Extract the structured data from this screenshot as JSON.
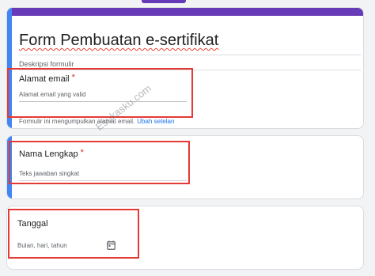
{
  "form": {
    "title": "Form Pembuatan e-sertifikat",
    "description_placeholder": "Deskripsi formulir"
  },
  "email_question": {
    "label": "Alamat email",
    "required_mark": "*",
    "placeholder": "Alamat email yang valid",
    "collection_note": "Formulir ini mengumpulkan alamat email.",
    "change_link": "Ubah setelan"
  },
  "name_question": {
    "label": "Nama Lengkap",
    "required_mark": "*",
    "placeholder": "Teks jawaban singkat"
  },
  "date_question": {
    "label": "Tanggal",
    "placeholder": "Bulan, hari, tahun",
    "icon": "calendar-icon"
  },
  "watermark": "Esukasku.com",
  "colors": {
    "theme": "#673ab7",
    "active_accent": "#4285f4",
    "required": "#d93025",
    "link": "#1a73e8",
    "highlight_box": "#e53935"
  }
}
